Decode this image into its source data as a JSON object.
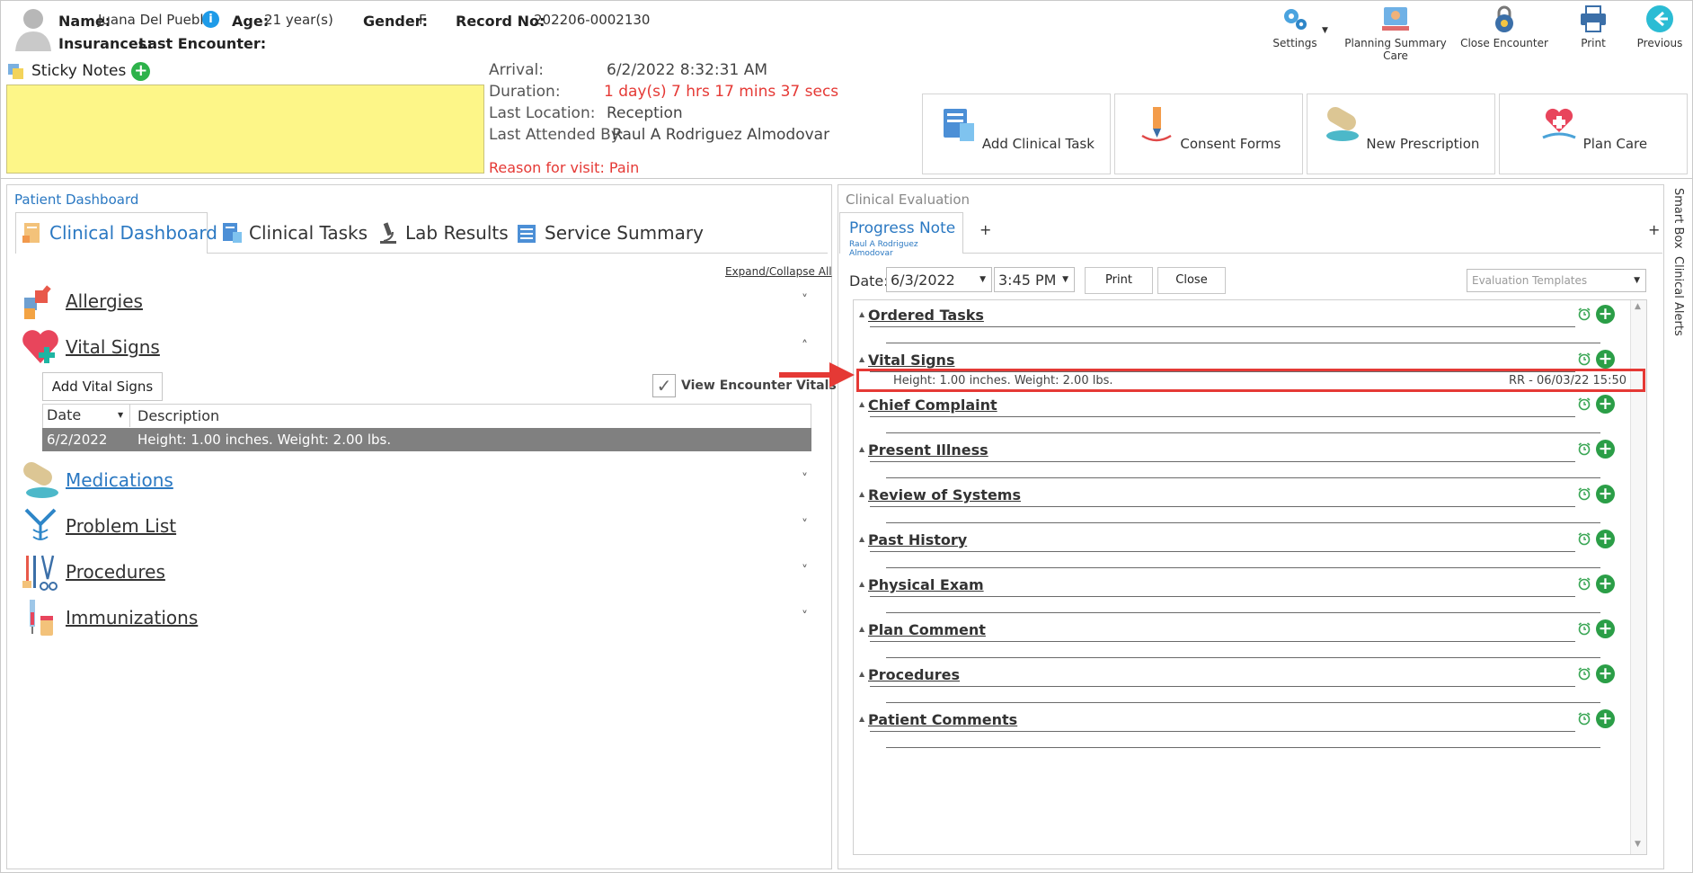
{
  "patient": {
    "name_label": "Name:",
    "name": "Juana Del Pueblo",
    "age_label": "Age:",
    "age": "21 year(s)",
    "gender_label": "Gender:",
    "gender": "F",
    "record_label": "Record No:",
    "record": "202206-0002130",
    "insurances_label": "Insurances:",
    "last_encounter_label": "Last Encounter:",
    "info_icon": "i"
  },
  "toolbar": {
    "settings": "Settings",
    "planning": "Planning Summary Care",
    "close_encounter": "Close Encounter",
    "print": "Print",
    "previous": "Previous"
  },
  "sticky": {
    "label": "Sticky Notes",
    "plus": "+"
  },
  "encounter": {
    "arrival_label": "Arrival:",
    "arrival": "6/2/2022 8:32:31 AM",
    "duration_label": "Duration:",
    "duration": "1 day(s) 7 hrs 17 mins 37 secs",
    "location_label": "Last Location:",
    "location": "Reception",
    "attended_label": "Last Attended By:",
    "attended": "Raul A Rodriguez Almodovar",
    "reason": "Reason for visit: Pain"
  },
  "actions": {
    "add_task": "Add Clinical Task",
    "consent": "Consent Forms",
    "prescription": "New Prescription",
    "plan_care": "Plan Care"
  },
  "dashboard": {
    "title": "Patient Dashboard",
    "tabs": [
      "Clinical Dashboard",
      "Clinical Tasks",
      "Lab Results",
      "Service Summary"
    ],
    "expand": "Expand/Collapse All",
    "sections": [
      "Allergies",
      "Vital Signs",
      "Medications",
      "Problem List",
      "Procedures",
      "Immunizations"
    ],
    "add_vitals": "Add Vital Signs",
    "view_vitals": "View Encounter Vitals",
    "col_date": "Date",
    "col_desc": "Description",
    "row_date": "6/2/2022",
    "row_desc": "Height: 1.00 inches. Weight: 2.00 lbs."
  },
  "evaluation": {
    "title": "Clinical Evaluation",
    "tab": "Progress Note",
    "tab_sub": "Raul A Rodriguez Almodovar",
    "plus": "+",
    "date_label": "Date:",
    "date": "6/3/2022",
    "time": "3:45 PM",
    "print": "Print",
    "close": "Close",
    "templates": "Evaluation Templates",
    "sections": [
      "Ordered Tasks",
      "Vital Signs",
      "Chief Complaint",
      "Present Illness",
      "Review of Systems",
      "Past History",
      "Physical Exam",
      "Plan Comment",
      "Procedures",
      "Patient Comments"
    ],
    "vital_entry": "Height: 1.00 inches. Weight: 2.00 lbs.",
    "vital_stamp": "RR - 06/03/22 15:50",
    "add_sign": "+"
  },
  "side": {
    "smart_box": "Smart Box",
    "clinical_alerts": "Clinical Alerts"
  },
  "colors": {
    "accent": "#2a78c2",
    "red_text": "#e53935",
    "highlight_box": "#e53935",
    "sticky_bg": "#fdf688",
    "selected_row": "#808080",
    "plus_green": "#2db24a"
  }
}
